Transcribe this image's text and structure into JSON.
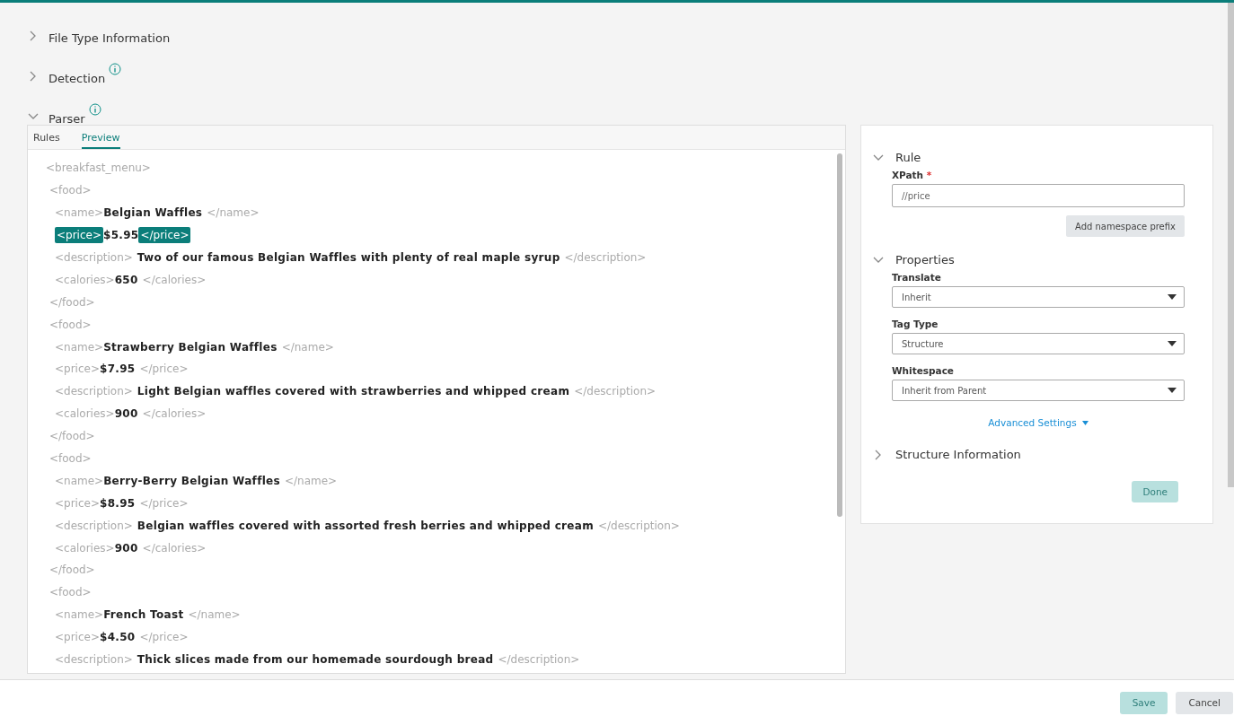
{
  "sections": [
    {
      "title": "File Type Information",
      "expanded": false,
      "info": false
    },
    {
      "title": "Detection",
      "expanded": false,
      "info": true
    },
    {
      "title": "Parser",
      "expanded": true,
      "info": true
    }
  ],
  "parser": {
    "tabs": [
      {
        "label": "Rules",
        "selected": false
      },
      {
        "label": "Preview",
        "selected": true
      }
    ],
    "preview": {
      "open": "<breakfast_menu>",
      "children": [
        {
          "open": "<food>",
          "close": "</food>",
          "children": [
            {
              "open": "<name>",
              "text": "Belgian Waffles",
              "close": "</name>",
              "selected": false
            },
            {
              "open": "<price>",
              "text": "$5.95",
              "close": "</price>",
              "selected": true
            },
            {
              "open": "<description>",
              "text": "Two of our famous Belgian Waffles with plenty of real maple syrup",
              "close": "</description>",
              "selected": false
            },
            {
              "open": "<calories>",
              "text": "650",
              "close": "</calories>",
              "selected": false
            }
          ]
        },
        {
          "open": "<food>",
          "close": "</food>",
          "children": [
            {
              "open": "<name>",
              "text": "Strawberry Belgian Waffles",
              "close": "</name>",
              "selected": false
            },
            {
              "open": "<price>",
              "text": "$7.95",
              "close": "</price>",
              "selected": false
            },
            {
              "open": "<description>",
              "text": "Light Belgian waffles covered with strawberries and whipped cream",
              "close": "</description>",
              "selected": false
            },
            {
              "open": "<calories>",
              "text": "900",
              "close": "</calories>",
              "selected": false
            }
          ]
        },
        {
          "open": "<food>",
          "close": "</food>",
          "children": [
            {
              "open": "<name>",
              "text": "Berry-Berry Belgian Waffles",
              "close": "</name>",
              "selected": false
            },
            {
              "open": "<price>",
              "text": "$8.95",
              "close": "</price>",
              "selected": false
            },
            {
              "open": "<description>",
              "text": "Belgian waffles covered with assorted fresh berries and whipped cream",
              "close": "</description>",
              "selected": false
            },
            {
              "open": "<calories>",
              "text": "900",
              "close": "</calories>",
              "selected": false
            }
          ]
        },
        {
          "open": "<food>",
          "children": [
            {
              "open": "<name>",
              "text": "French Toast",
              "close": "</name>",
              "selected": false
            },
            {
              "open": "<price>",
              "text": "$4.50",
              "close": "</price>",
              "selected": false
            },
            {
              "open": "<description>",
              "text": "Thick slices made from our homemade sourdough bread",
              "close": "</description>",
              "selected": false
            }
          ]
        }
      ]
    }
  },
  "rule_panel": {
    "rule": {
      "title": "Rule",
      "expanded": true,
      "xpath_label": "XPath",
      "required_mark": "*",
      "xpath_value": "//price",
      "namespace_button": "Add namespace prefix"
    },
    "properties": {
      "title": "Properties",
      "expanded": true,
      "fields": [
        {
          "label": "Translate",
          "value": "Inherit"
        },
        {
          "label": "Tag Type",
          "value": "Structure"
        },
        {
          "label": "Whitespace",
          "value": "Inherit from Parent"
        }
      ],
      "advanced_link": "Advanced Settings"
    },
    "structure": {
      "title": "Structure Information",
      "expanded": false
    },
    "done_button": {
      "label": "Done",
      "disabled": true
    }
  },
  "footer": {
    "buttons": [
      {
        "label": "Save",
        "kind": "primary",
        "disabled": true
      },
      {
        "label": "Cancel",
        "kind": "secondary",
        "disabled": false
      }
    ]
  }
}
